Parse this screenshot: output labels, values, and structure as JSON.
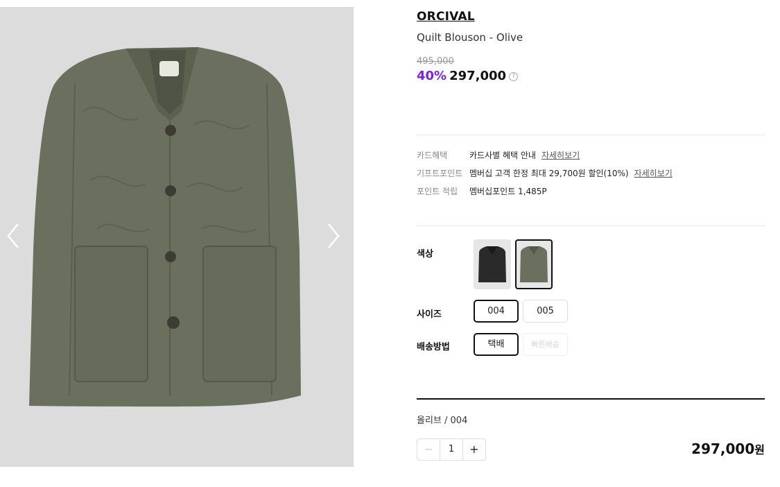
{
  "product": {
    "brand": "ORCIVAL",
    "name": "Quilt Blouson - Olive",
    "original_price": "495,000",
    "discount": "40%",
    "sale_price": "297,000",
    "help_icon": "?"
  },
  "benefits": [
    {
      "label": "카드혜택",
      "value": "카드사별 혜택 안내",
      "link": "자세히보기"
    },
    {
      "label": "기프트포인트",
      "value": "멤버십 고객 한정 최대 29,700원 할인(10%)",
      "link": "자세히보기"
    },
    {
      "label": "포인트 적립",
      "value": "멤버십포인트 1,485P",
      "link": ""
    }
  ],
  "options": {
    "color_label": "색상",
    "colors": [
      {
        "name": "black",
        "hex": "#2a2a2a",
        "selected": false
      },
      {
        "name": "olive",
        "hex": "#6b6f5e",
        "selected": true
      }
    ],
    "size_label": "사이즈",
    "sizes": [
      "004",
      "005"
    ],
    "selected_size": "004",
    "shipping_label": "배송방법",
    "shipping": [
      "택배",
      "빠른배송"
    ],
    "selected_shipping": "택배"
  },
  "selection": {
    "summary": "올리브 / 004",
    "minus": "−",
    "quantity": "1",
    "plus": "+",
    "total_amount": "297,000",
    "total_unit": "원"
  },
  "gallery": {
    "prev_icon": "chevron-left-icon",
    "next_icon": "chevron-right-icon",
    "jacket_color": "#6b6f5e",
    "background": "#dcdcdc"
  }
}
